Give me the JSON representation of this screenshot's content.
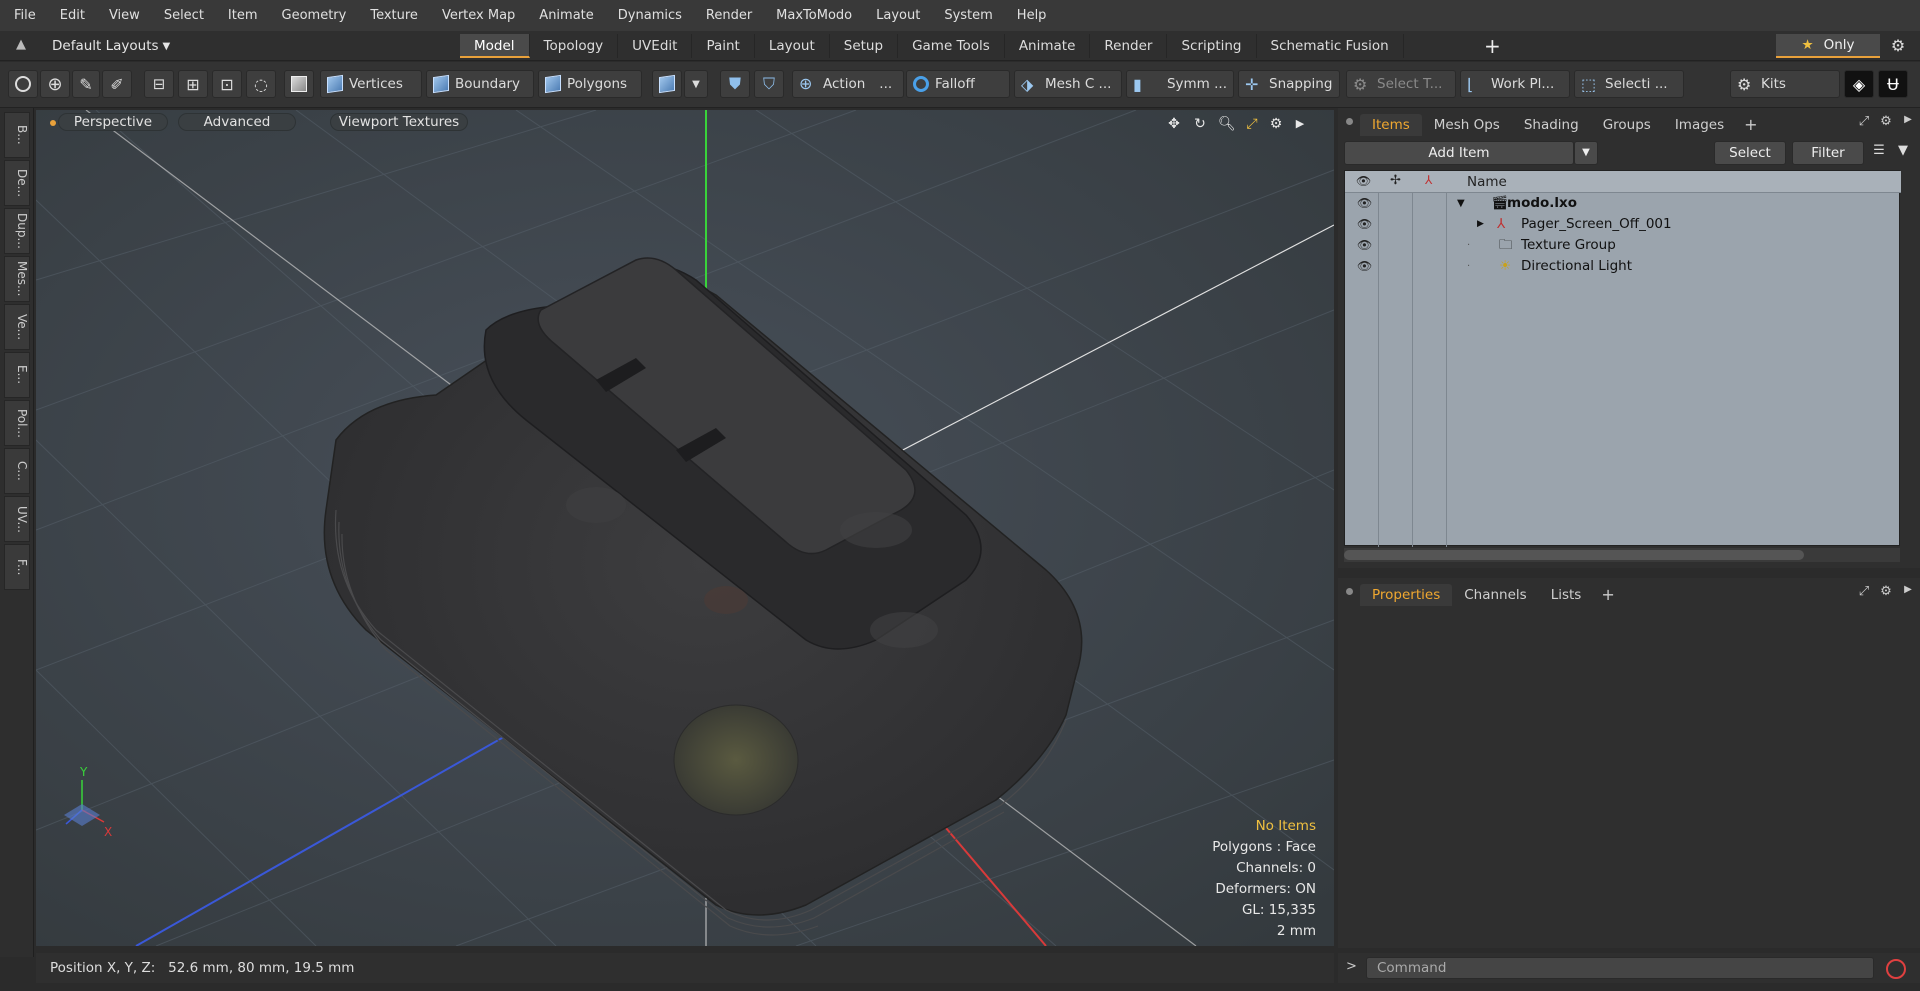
{
  "menu": [
    "File",
    "Edit",
    "View",
    "Select",
    "Item",
    "Geometry",
    "Texture",
    "Vertex Map",
    "Animate",
    "Dynamics",
    "Render",
    "MaxToModo",
    "Layout",
    "System",
    "Help"
  ],
  "layout": {
    "dropdown_label": "Default Layouts",
    "tabs": [
      "Model",
      "Topology",
      "UVEdit",
      "Paint",
      "Layout",
      "Setup",
      "Game Tools",
      "Animate",
      "Render",
      "Scripting",
      "Schematic Fusion"
    ],
    "active_tab": "Model",
    "only_label": "Only"
  },
  "toolbar": {
    "vertices": "Vertices",
    "boundary": "Boundary",
    "polygons": "Polygons",
    "action": "Action",
    "action_more": "...",
    "falloff": "Falloff",
    "mesh_c": "Mesh C ...",
    "symm": "Symm ...",
    "snapping": "Snapping",
    "select_t": "Select T...",
    "work_pl": "Work Pl...",
    "selecti": "Selecti ...",
    "kits": "Kits"
  },
  "left_tabs": [
    "B...",
    "De...",
    "Dup...",
    "Mes...",
    "Ve...",
    "E...",
    "Pol...",
    "C...",
    "UV...",
    "F..."
  ],
  "viewport": {
    "perspective": "Perspective",
    "advanced": "Advanced",
    "viewport_textures": "Viewport Textures",
    "axis_y": "Y",
    "axis_x": "X",
    "stats": {
      "no_items": "No Items",
      "polygons": "Polygons : Face",
      "channels": "Channels: 0",
      "deformers": "Deformers: ON",
      "gl": "GL: 15,335",
      "scale": "2 mm"
    }
  },
  "status": {
    "position": "Position X, Y, Z:   52.6 mm, 80 mm, 19.5 mm"
  },
  "items_panel": {
    "tabs": [
      "Items",
      "Mesh Ops",
      "Shading",
      "Groups",
      "Images"
    ],
    "active_tab": "Items",
    "add_item": "Add Item",
    "select": "Select",
    "filter": "Filter",
    "name_header": "Name",
    "rows": [
      {
        "label": "modo.lxo",
        "bold": true
      },
      {
        "label": "Pager_Screen_Off_001"
      },
      {
        "label": "Texture Group"
      },
      {
        "label": "Directional Light"
      }
    ]
  },
  "props_panel": {
    "tabs": [
      "Properties",
      "Channels",
      "Lists"
    ],
    "active_tab": "Properties"
  },
  "command": {
    "placeholder": "Command",
    "prompt": ">"
  },
  "colors": {
    "accent": "#e9a13b",
    "viewport_bg": "#3c4346",
    "tree_bg": "#9ba4ad"
  }
}
